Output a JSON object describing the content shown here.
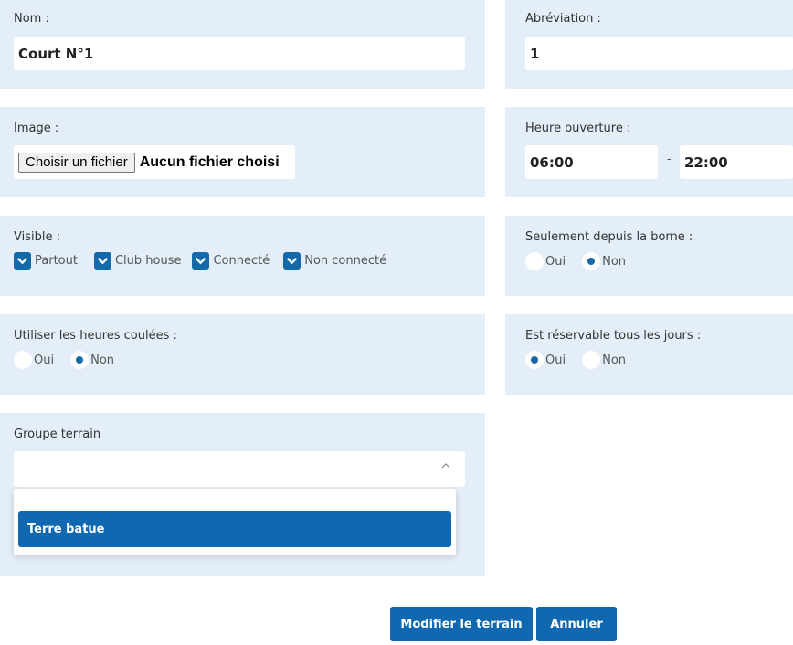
{
  "nom": {
    "label": "Nom :",
    "value": "Court N°1"
  },
  "abreviation": {
    "label": "Abréviation :",
    "value": "1"
  },
  "image": {
    "label": "Image :",
    "button": "Choisir un fichier",
    "status": "Aucun fichier choisi"
  },
  "heure": {
    "label": "Heure ouverture :",
    "open": "06:00",
    "sep": "-",
    "close": "22:00"
  },
  "visible": {
    "label": "Visible :",
    "options": [
      {
        "label": "Partout",
        "checked": true
      },
      {
        "label": "Club house",
        "checked": true
      },
      {
        "label": "Connecté",
        "checked": true
      },
      {
        "label": "Non connecté",
        "checked": true
      }
    ]
  },
  "borne": {
    "label": "Seulement depuis la borne :",
    "yes": "Oui",
    "no": "Non",
    "selected": "Non"
  },
  "heures_coulees": {
    "label": "Utiliser les heures coulées :",
    "yes": "Oui",
    "no": "Non",
    "selected": "Non"
  },
  "tous_jours": {
    "label": "Est réservable tous les jours :",
    "yes": "Oui",
    "no": "Non",
    "selected": "Oui"
  },
  "groupe": {
    "label": "Groupe terrain",
    "value": "",
    "options": [
      "Terre batue"
    ],
    "highlighted": "Terre batue"
  },
  "actions": {
    "submit": "Modifier le terrain",
    "cancel": "Annuler"
  },
  "colors": {
    "panel": "#e4eef8",
    "accent": "#1069b0"
  }
}
